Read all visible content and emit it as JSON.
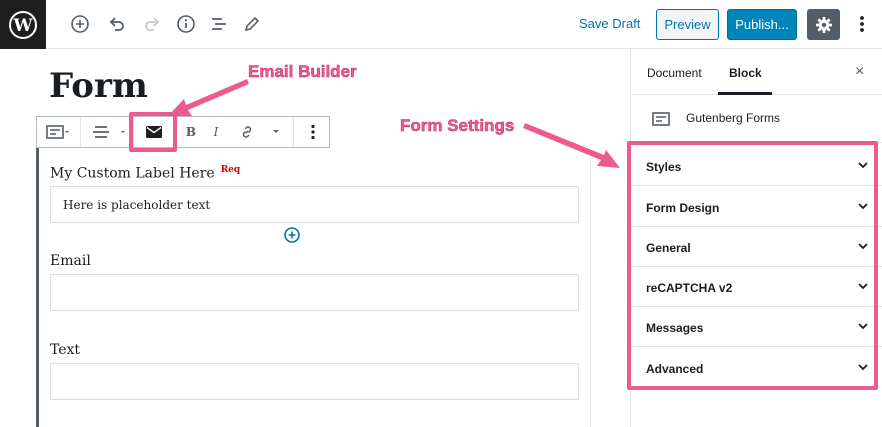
{
  "toolbar": {
    "save_draft": "Save Draft",
    "preview": "Preview",
    "publish": "Publish...",
    "icons": [
      "wordpress-logo",
      "add-block-icon",
      "undo-icon",
      "redo-icon",
      "info-icon",
      "outline-icon",
      "edit-icon",
      "gear-icon",
      "more-vertical-icon"
    ]
  },
  "editor": {
    "title": "Form",
    "block_toolbar": {
      "icons": [
        "form-block-icon",
        "align-icon",
        "email-icon",
        "bold-icon",
        "italic-icon",
        "link-icon",
        "more-formatting-icon",
        "more-options-icon"
      ],
      "bold_glyph": "B",
      "italic_glyph": "I"
    },
    "fields": [
      {
        "label": "My Custom Label Here",
        "required_badge": "Req",
        "value": "Here is placeholder text"
      },
      {
        "label": "Email",
        "value": ""
      },
      {
        "label": "Text",
        "value": ""
      }
    ]
  },
  "sidebar": {
    "tabs": [
      "Document",
      "Block"
    ],
    "active_tab": "Block",
    "close": "×",
    "block_name": "Gutenberg Forms",
    "panels": [
      "Styles",
      "Form Design",
      "General",
      "reCAPTCHA v2",
      "Messages",
      "Advanced"
    ]
  },
  "annotations": {
    "email_builder": "Email Builder",
    "form_settings": "Form Settings",
    "color": "#ec5a8f"
  },
  "colors": {
    "accent": "#0073aa",
    "publish": "#0085ba",
    "required": "#dd0000"
  }
}
